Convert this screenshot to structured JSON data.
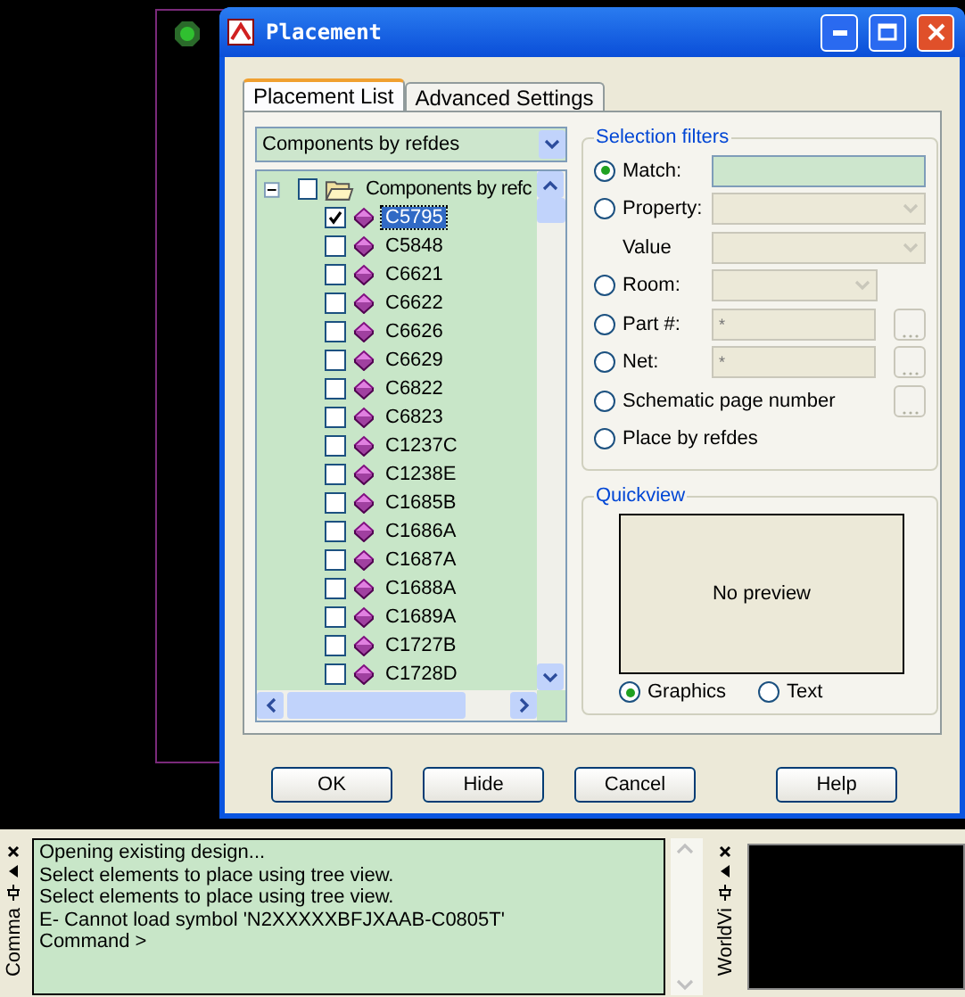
{
  "window": {
    "title": "Placement"
  },
  "tabs": [
    {
      "label": "Placement List",
      "selected": true
    },
    {
      "label": "Advanced Settings",
      "selected": false
    }
  ],
  "list_mode": {
    "value": "Components by refdes"
  },
  "tree": {
    "label": "Components by refc",
    "expanded": true,
    "checked": false,
    "children": [
      {
        "label": "C5795",
        "checked": true,
        "selected": true
      },
      {
        "label": "C5848",
        "checked": false,
        "selected": false
      },
      {
        "label": "C6621",
        "checked": false,
        "selected": false
      },
      {
        "label": "C6622",
        "checked": false,
        "selected": false
      },
      {
        "label": "C6626",
        "checked": false,
        "selected": false
      },
      {
        "label": "C6629",
        "checked": false,
        "selected": false
      },
      {
        "label": "C6822",
        "checked": false,
        "selected": false
      },
      {
        "label": "C6823",
        "checked": false,
        "selected": false
      },
      {
        "label": "C1237C",
        "checked": false,
        "selected": false
      },
      {
        "label": "C1238E",
        "checked": false,
        "selected": false
      },
      {
        "label": "C1685B",
        "checked": false,
        "selected": false
      },
      {
        "label": "C1686A",
        "checked": false,
        "selected": false
      },
      {
        "label": "C1687A",
        "checked": false,
        "selected": false
      },
      {
        "label": "C1688A",
        "checked": false,
        "selected": false
      },
      {
        "label": "C1689A",
        "checked": false,
        "selected": false
      },
      {
        "label": "C1727B",
        "checked": false,
        "selected": false
      },
      {
        "label": "C1728D",
        "checked": false,
        "selected": false
      }
    ]
  },
  "selection_filters": {
    "title": "Selection filters",
    "options": [
      {
        "kind": "text",
        "label": "Match:",
        "selected": true,
        "disabled": false
      },
      {
        "kind": "dropdown",
        "label": "Property:",
        "selected": false,
        "disabled": true
      },
      {
        "kind": "subdropdown",
        "label": "Value",
        "disabled": true
      },
      {
        "kind": "shortdropdown",
        "label": "Room:",
        "selected": false,
        "disabled": true
      },
      {
        "kind": "browse-text",
        "label": "Part #:",
        "placeholder": "*",
        "selected": false,
        "disabled": true
      },
      {
        "kind": "browse-text",
        "label": "Net:",
        "placeholder": "*",
        "selected": false,
        "disabled": true
      },
      {
        "kind": "browse",
        "label": "Schematic page number",
        "selected": false,
        "disabled": true
      },
      {
        "kind": "plain",
        "label": "Place by refdes",
        "selected": false
      }
    ]
  },
  "quickview": {
    "title": "Quickview",
    "preview_text": "No preview",
    "modes": [
      {
        "label": "Graphics",
        "selected": true
      },
      {
        "label": "Text",
        "selected": false
      }
    ]
  },
  "buttons": [
    "OK",
    "Hide",
    "Cancel",
    "Help"
  ],
  "command_panel": {
    "tab_label": "Comma",
    "lines": [
      "Opening existing design...",
      "Select elements to place using tree view.",
      "Select elements to place using tree view.",
      "E- Cannot load symbol 'N2XXXXXBFJXAAB-C0805T'",
      "Command >"
    ]
  },
  "world_view": {
    "tab_label": "WorldVi"
  }
}
